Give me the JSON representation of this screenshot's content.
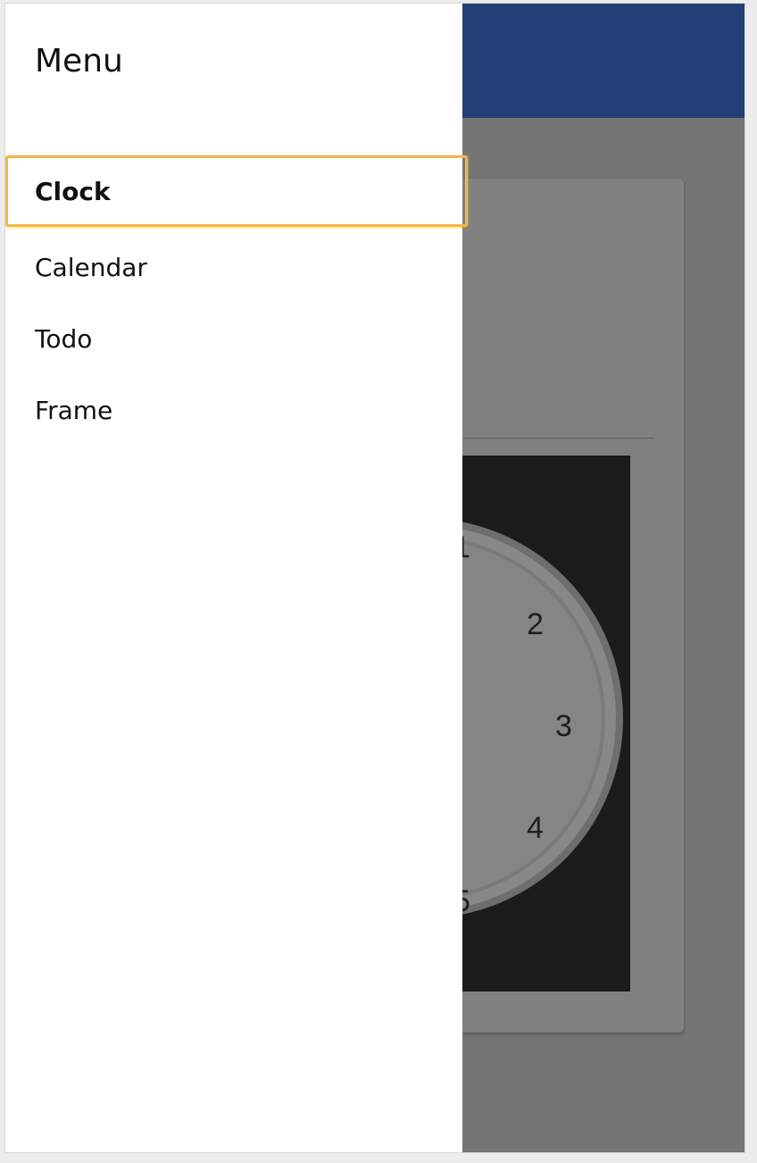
{
  "drawer": {
    "title": "Menu",
    "items": [
      {
        "label": "Clock",
        "selected": true
      },
      {
        "label": "Calendar",
        "selected": false
      },
      {
        "label": "Todo",
        "selected": false
      },
      {
        "label": "Frame",
        "selected": false
      }
    ]
  },
  "clock": {
    "numerals": [
      "1",
      "2",
      "3",
      "4",
      "5"
    ]
  },
  "colors": {
    "app_bar": "#224077",
    "scrim_background": "#777777",
    "focus_outline": "#f0b945"
  }
}
